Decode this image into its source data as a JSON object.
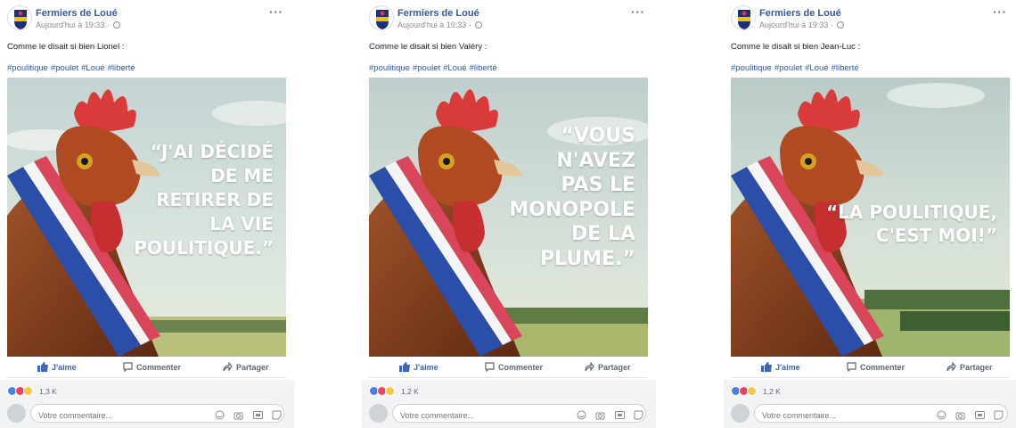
{
  "page_name": "Fermiers de Loué",
  "timestamp": "Aujourd'hui à 19:33 ·",
  "more_label": "···",
  "logo_text": "LOUÉ",
  "hashtags": [
    "#poulitique",
    "#poulet",
    "#Loué",
    "#liberté"
  ],
  "actions": {
    "like": "J'aime",
    "comment": "Commenter",
    "share": "Partager"
  },
  "comment_placeholder": "Votre commentaire...",
  "icons": [
    "emoji-icon",
    "camera-icon",
    "gif-icon",
    "sticker-icon"
  ],
  "colors": {
    "link": "#385898",
    "like": "#4267b2",
    "flag_blue": "#2b4fa8",
    "flag_red": "#d9455a",
    "comb_red": "#d93a3a"
  },
  "posts": [
    {
      "text": "Comme le disait si bien Lionel :",
      "quote_lines": [
        "“J'AI DÉCIDÉ",
        "DE ME",
        "RETIRER DE",
        "LA VIE",
        "POULITIQUE.”"
      ],
      "reaction_count": "1,3 K"
    },
    {
      "text": "Comme le disait si bien Valéry :",
      "quote_lines": [
        "“VOUS",
        "N'AVEZ",
        "PAS LE",
        "MONOPOLE",
        "DE LA",
        "PLUME.”"
      ],
      "reaction_count": "1,2 K"
    },
    {
      "text": "Comme le disait si bien Jean-Luc :",
      "quote_lines": [
        "“LA POULITIQUE,",
        "C'EST MOI!”"
      ],
      "reaction_count": "1,2 K"
    }
  ]
}
